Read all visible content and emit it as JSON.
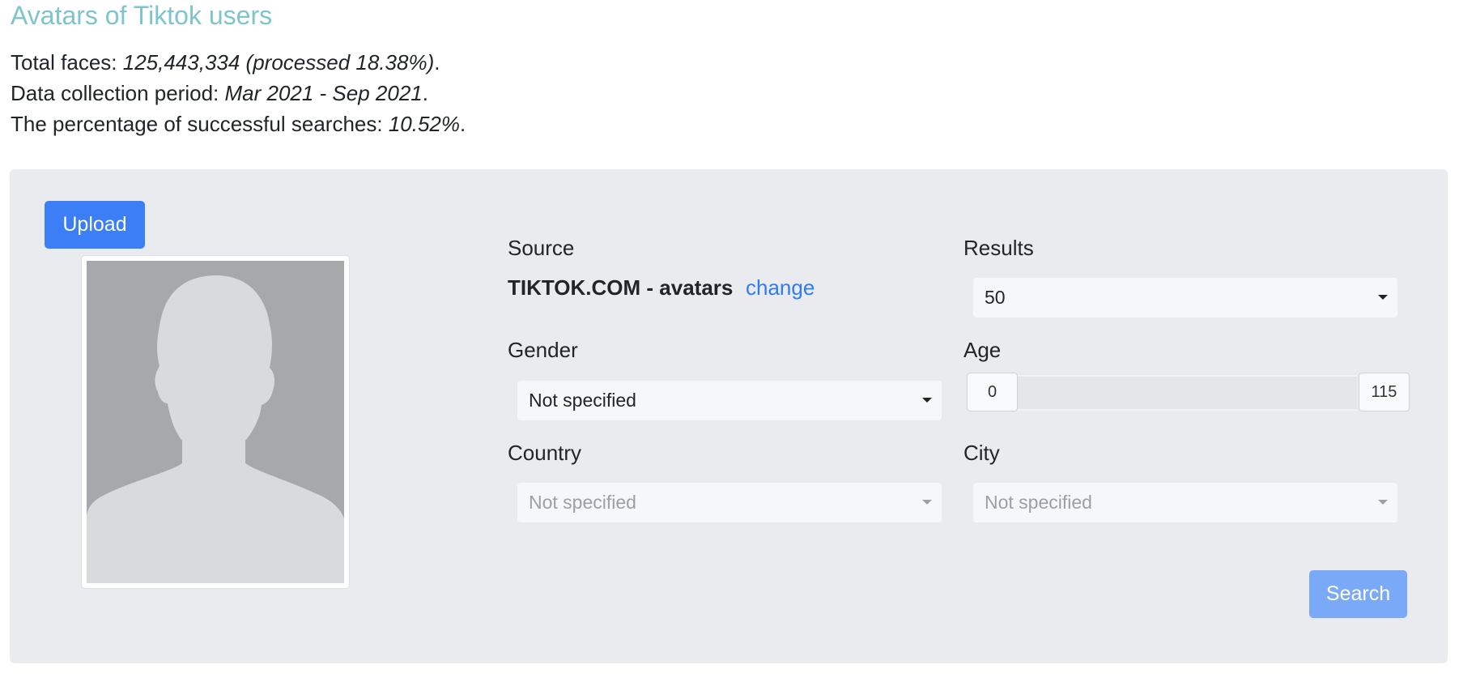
{
  "page": {
    "title": "Avatars of Tiktok users",
    "stats": {
      "total_faces_label": "Total faces: ",
      "total_faces_value": "125,443,334 (processed 18.38%)",
      "period_label": "Data collection period: ",
      "period_value": "Mar 2021 - Sep 2021",
      "success_label": "The percentage of successful searches: ",
      "success_value": "10.52%",
      "terminator": "."
    }
  },
  "form": {
    "upload_label": "Upload",
    "source": {
      "label": "Source",
      "value": "TIKTOK.COM - avatars",
      "change_label": "change"
    },
    "results": {
      "label": "Results",
      "selected": "50"
    },
    "gender": {
      "label": "Gender",
      "selected": "Not specified"
    },
    "age": {
      "label": "Age",
      "min": "0",
      "max": "115"
    },
    "country": {
      "label": "Country",
      "selected": "Not specified",
      "disabled": true
    },
    "city": {
      "label": "City",
      "selected": "Not specified",
      "disabled": true
    },
    "search_label": "Search"
  },
  "colors": {
    "title": "#7ec4cc",
    "primary_button": "#3b7ef5",
    "disabled_button": "#7aa9f7",
    "link": "#2f7cf6",
    "panel_bg": "#e9ebef"
  },
  "icons": {
    "placeholder_avatar": "person-silhouette-icon",
    "select_caret": "caret-down-icon"
  }
}
